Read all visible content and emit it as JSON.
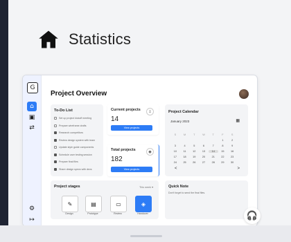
{
  "header": {
    "title": "Statistics",
    "icon": "home-icon"
  },
  "app": {
    "page_title": "Project Overview",
    "sidebar": {
      "icons": [
        "logo-icon",
        "home-icon",
        "inbox-icon",
        "shuffle-icon",
        "settings-icon",
        "logout-icon"
      ]
    },
    "todo": {
      "title": "To-Do List",
      "items": [
        {
          "label": "Set up project kickoff meeting",
          "done": false
        },
        {
          "label": "Prepare wireframe drafts",
          "done": false
        },
        {
          "label": "Research competitors",
          "done": true
        },
        {
          "label": "Review design system with team",
          "done": true
        },
        {
          "label": "Update style guide components",
          "done": false
        },
        {
          "label": "Schedule user testing session",
          "done": true
        },
        {
          "label": "Prepare final files",
          "done": true
        },
        {
          "label": "Share design specs with devs",
          "done": true
        }
      ]
    },
    "current_projects": {
      "label": "Current projects",
      "count": "14",
      "button": "View projects"
    },
    "total_projects": {
      "label": "Total projects",
      "count": "182",
      "button": "View projects"
    },
    "calendar": {
      "title": "Project Calendar",
      "month": "January 2023",
      "weekdays": [
        "S",
        "M",
        "T",
        "W",
        "T",
        "F",
        "S"
      ],
      "rows": [
        [
          "",
          "",
          "",
          "",
          "",
          "1",
          "2"
        ],
        [
          "3",
          "4",
          "5",
          "6",
          "7",
          "8",
          "9"
        ],
        [
          "10",
          "11",
          "12",
          "13",
          "14",
          "15",
          "16"
        ],
        [
          "17",
          "18",
          "19",
          "20",
          "21",
          "22",
          "23"
        ],
        [
          "24",
          "25",
          "26",
          "27",
          "28",
          "29",
          "30"
        ]
      ],
      "today": "14",
      "prev": "<",
      "next": ">"
    },
    "stages": {
      "title": "Project stages",
      "filter": "This week",
      "items": [
        {
          "label": "Design",
          "icon": "pencil-icon",
          "active": false
        },
        {
          "label": "Prototype",
          "icon": "grid-icon",
          "active": false
        },
        {
          "label": "Review",
          "icon": "monitor-icon",
          "active": false
        },
        {
          "label": "Handover",
          "icon": "box-icon",
          "active": true
        }
      ]
    },
    "quick_note": {
      "title": "Quick Note",
      "text": "Don't forget to send the final files."
    }
  },
  "support": {
    "icon": "headset-icon"
  },
  "colors": {
    "accent": "#2d7cf6",
    "frame": "#1f2433",
    "panel": "#f3f4f6"
  }
}
